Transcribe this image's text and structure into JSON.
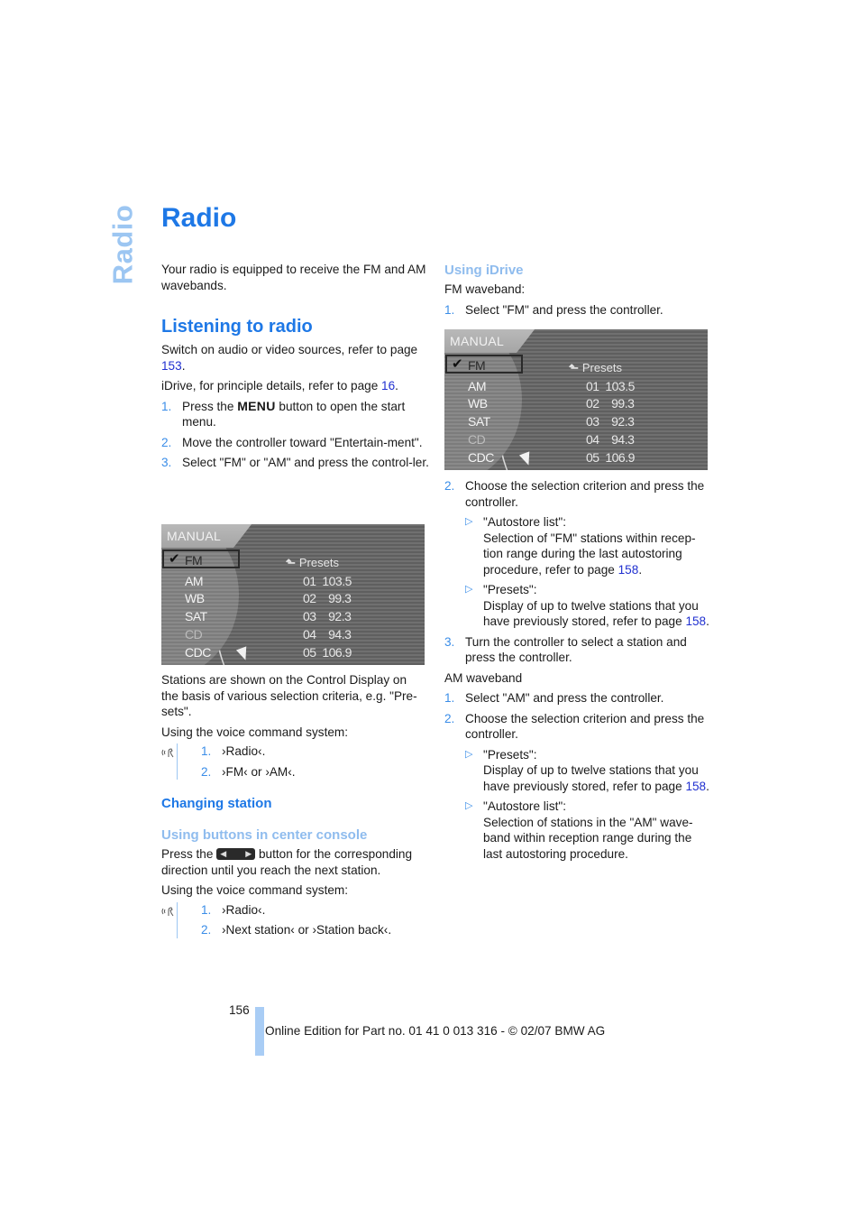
{
  "side_tab": "Radio",
  "title": "Radio",
  "intro": "Your radio is equipped to receive the FM and AM wavebands.",
  "listening": {
    "heading": "Listening to radio",
    "p1_text": "Switch on audio or video sources, refer to page ",
    "p1_link": "153",
    "p1_end": ".",
    "p2_text": "iDrive, for principle details, refer to page ",
    "p2_link": "16",
    "p2_end": ".",
    "steps": [
      {
        "num": "1.",
        "pre": "Press the ",
        "keyword": "MENU",
        "post": " button to open the start menu."
      },
      {
        "num": "2.",
        "text": "Move the controller toward \"Entertain-ment\"."
      },
      {
        "num": "3.",
        "text": "Select \"FM\" or \"AM\" and press the control-ler."
      }
    ],
    "after_screen": "Stations are shown on the Control Display on the basis of various selection criteria, e.g. \"Pre-sets\".",
    "voice_intro": "Using the voice command system:",
    "voice_steps": [
      {
        "num": "1.",
        "text": "›Radio‹."
      },
      {
        "num": "2.",
        "text": "›FM‹ or ›AM‹."
      }
    ]
  },
  "screen": {
    "header": "MANUAL",
    "sources": [
      {
        "label": "FM",
        "selected": true,
        "dim": false
      },
      {
        "label": "AM",
        "selected": false,
        "dim": false
      },
      {
        "label": "WB",
        "selected": false,
        "dim": false
      },
      {
        "label": "SAT",
        "selected": false,
        "dim": false
      },
      {
        "label": "CD",
        "selected": false,
        "dim": true
      },
      {
        "label": "CDC",
        "selected": false,
        "dim": false
      }
    ],
    "check_glyph": "✔",
    "presets_label": "Presets",
    "presets_arrow": "⬑",
    "presets": [
      {
        "no": "01",
        "freq": "103.5"
      },
      {
        "no": "02",
        "freq": "99.3"
      },
      {
        "no": "03",
        "freq": "92.3"
      },
      {
        "no": "04",
        "freq": "94.3"
      },
      {
        "no": "05",
        "freq": "106.9"
      }
    ]
  },
  "changing": {
    "heading": "Changing station",
    "subheading": "Using buttons in center console",
    "p1_pre": "Press the ",
    "p1_post": " button for the corresponding direction until you reach the next station.",
    "voice_intro": "Using the voice command system:",
    "voice_steps": [
      {
        "num": "1.",
        "text": "›Radio‹."
      },
      {
        "num": "2.",
        "text": "›Next station‹ or ›Station back‹."
      }
    ]
  },
  "idrive": {
    "heading": "Using iDrive",
    "fm_label": "FM waveband:",
    "fm_step1": {
      "num": "1.",
      "text": "Select \"FM\" and press the controller."
    },
    "fm_step2": {
      "num": "2.",
      "text": "Choose the selection criterion and press the controller."
    },
    "fm_bullets": [
      {
        "title": "\"Autostore list\":",
        "text": "Selection of \"FM\" stations within recep-tion range during the last autostoring procedure, refer to page ",
        "link": "158",
        "end": "."
      },
      {
        "title": "\"Presets\":",
        "text": "Display of up to twelve stations that you have previously stored, refer to page ",
        "link": "158",
        "end": "."
      }
    ],
    "fm_step3": {
      "num": "3.",
      "text": "Turn the controller to select a station and press the controller."
    },
    "am_label": "AM waveband",
    "am_step1": {
      "num": "1.",
      "text": "Select \"AM\" and press the controller."
    },
    "am_step2": {
      "num": "2.",
      "text": "Choose the selection criterion and press the controller."
    },
    "am_bullets": [
      {
        "title": "\"Presets\":",
        "text": "Display of up to twelve stations that you have previously stored, refer to page ",
        "link": "158",
        "end": "."
      },
      {
        "title": "\"Autostore list\":",
        "text": "Selection of stations in the \"AM\" wave-band within reception range during the last autostoring procedure.",
        "link": null,
        "end": ""
      }
    ]
  },
  "bullet_glyph": "▷",
  "nav_button": {
    "left": "◀",
    "right": "▶"
  },
  "footer": {
    "page_number": "156",
    "text": "Online Edition for Part no. 01 41 0 013 316 - © 02/07 BMW AG"
  }
}
